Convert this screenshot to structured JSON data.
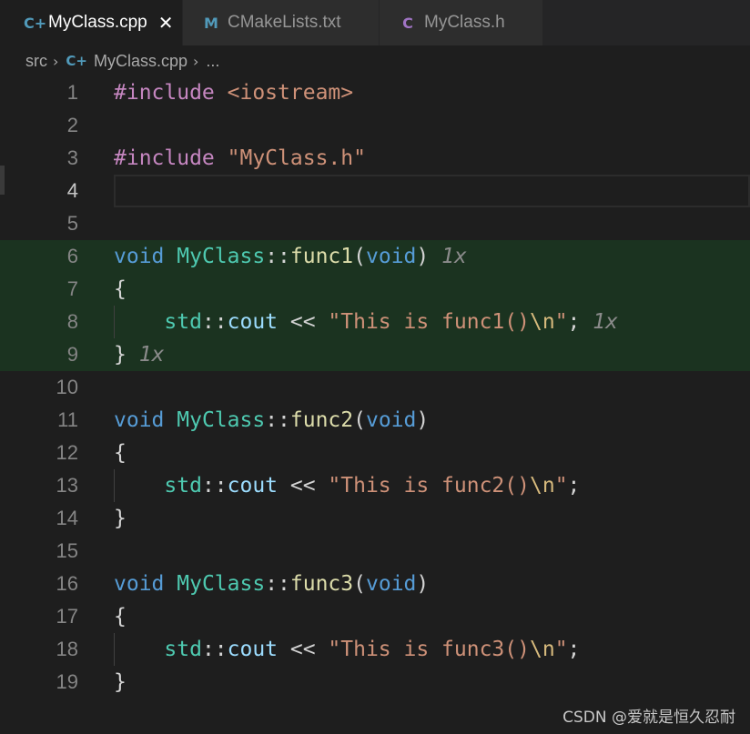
{
  "tabs": [
    {
      "label": "MyClass.cpp",
      "icon": "C+",
      "icon_color": "#519aba",
      "active": true,
      "closable": true
    },
    {
      "label": "CMakeLists.txt",
      "icon": "M",
      "icon_color": "#519aba",
      "active": false
    },
    {
      "label": "MyClass.h",
      "icon": "C",
      "icon_color": "#a074c4",
      "active": false
    }
  ],
  "tab_close_glyph": "✕",
  "breadcrumb": {
    "folder": "src",
    "file": "MyClass.cpp",
    "tail": "...",
    "separator": "›"
  },
  "editor": {
    "current_line": 4,
    "lines": [
      {
        "n": "1",
        "tokens": [
          [
            "pp",
            "#include"
          ],
          [
            "op",
            " "
          ],
          [
            "str",
            "<iostream>"
          ]
        ]
      },
      {
        "n": "2",
        "tokens": []
      },
      {
        "n": "3",
        "tokens": [
          [
            "pp",
            "#include"
          ],
          [
            "op",
            " "
          ],
          [
            "str",
            "\"MyClass.h\""
          ]
        ]
      },
      {
        "n": "4",
        "tokens": []
      },
      {
        "n": "5",
        "tokens": []
      },
      {
        "n": "6",
        "covered": true,
        "tokens": [
          [
            "kw",
            "void"
          ],
          [
            "op",
            " "
          ],
          [
            "type",
            "MyClass"
          ],
          [
            "op",
            "::"
          ],
          [
            "fn",
            "func1"
          ],
          [
            "op",
            "("
          ],
          [
            "kw",
            "void"
          ],
          [
            "op",
            ")"
          ],
          [
            "op",
            " "
          ],
          [
            "hint",
            "1x"
          ]
        ]
      },
      {
        "n": "7",
        "covered": true,
        "tokens": [
          [
            "op",
            "{"
          ]
        ]
      },
      {
        "n": "8",
        "covered": true,
        "guide": true,
        "tokens": [
          [
            "op",
            "    "
          ],
          [
            "type",
            "std"
          ],
          [
            "op",
            "::"
          ],
          [
            "var",
            "cout"
          ],
          [
            "op",
            " << "
          ],
          [
            "str",
            "\"This is func1()"
          ],
          [
            "esc",
            "\\n"
          ],
          [
            "str",
            "\""
          ],
          [
            "op",
            "; "
          ],
          [
            "hint",
            "1x"
          ]
        ]
      },
      {
        "n": "9",
        "covered": true,
        "tokens": [
          [
            "op",
            "}"
          ],
          [
            "op",
            " "
          ],
          [
            "hint",
            "1x"
          ]
        ]
      },
      {
        "n": "10",
        "tokens": []
      },
      {
        "n": "11",
        "tokens": [
          [
            "kw",
            "void"
          ],
          [
            "op",
            " "
          ],
          [
            "type",
            "MyClass"
          ],
          [
            "op",
            "::"
          ],
          [
            "fn",
            "func2"
          ],
          [
            "op",
            "("
          ],
          [
            "kw",
            "void"
          ],
          [
            "op",
            ")"
          ]
        ]
      },
      {
        "n": "12",
        "tokens": [
          [
            "op",
            "{"
          ]
        ]
      },
      {
        "n": "13",
        "guide": true,
        "tokens": [
          [
            "op",
            "    "
          ],
          [
            "type",
            "std"
          ],
          [
            "op",
            "::"
          ],
          [
            "var",
            "cout"
          ],
          [
            "op",
            " << "
          ],
          [
            "str",
            "\"This is func2()"
          ],
          [
            "esc",
            "\\n"
          ],
          [
            "str",
            "\""
          ],
          [
            "op",
            ";"
          ]
        ]
      },
      {
        "n": "14",
        "tokens": [
          [
            "op",
            "}"
          ]
        ]
      },
      {
        "n": "15",
        "tokens": []
      },
      {
        "n": "16",
        "tokens": [
          [
            "kw",
            "void"
          ],
          [
            "op",
            " "
          ],
          [
            "type",
            "MyClass"
          ],
          [
            "op",
            "::"
          ],
          [
            "fn",
            "func3"
          ],
          [
            "op",
            "("
          ],
          [
            "kw",
            "void"
          ],
          [
            "op",
            ")"
          ]
        ]
      },
      {
        "n": "17",
        "tokens": [
          [
            "op",
            "{"
          ]
        ]
      },
      {
        "n": "18",
        "guide": true,
        "tokens": [
          [
            "op",
            "    "
          ],
          [
            "type",
            "std"
          ],
          [
            "op",
            "::"
          ],
          [
            "var",
            "cout"
          ],
          [
            "op",
            " << "
          ],
          [
            "str",
            "\"This is func3()"
          ],
          [
            "esc",
            "\\n"
          ],
          [
            "str",
            "\""
          ],
          [
            "op",
            ";"
          ]
        ]
      },
      {
        "n": "19",
        "tokens": [
          [
            "op",
            "}"
          ]
        ]
      }
    ]
  },
  "watermark": "CSDN @爱就是恒久忍耐",
  "colors": {
    "editor_bg": "#1e1e1e",
    "coverage_bg": "#1b3320",
    "keyword": "#569cd6",
    "type": "#4ec9b0",
    "function": "#dcdcaa",
    "string": "#ce9178",
    "preprocessor": "#c586c0"
  }
}
